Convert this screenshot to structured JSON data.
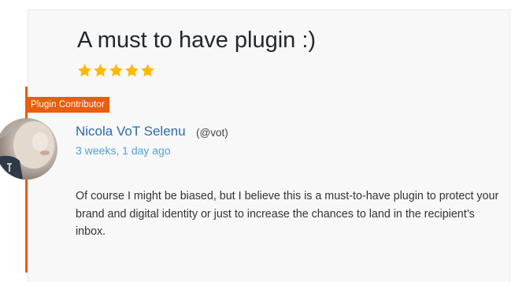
{
  "review": {
    "title": "A must to have plugin :)",
    "rating": 5,
    "rating_max": 5,
    "badge": "Plugin Contributor",
    "author": {
      "name": "Nicola VoT Selenu",
      "handle": "(@vot)"
    },
    "date": "3 weeks, 1 day ago",
    "body": "Of course I might be biased, but I believe this is a must-to-have plugin to protect your brand and digital identity or just to increase the chances to land in the recipient’s inbox."
  },
  "colors": {
    "accent": "#e95d0f",
    "star": "#ffb900",
    "link": "#2a6ba8",
    "date": "#4f9ed8"
  },
  "icons": {
    "star": "star-icon",
    "avatar": "avatar-photo"
  }
}
